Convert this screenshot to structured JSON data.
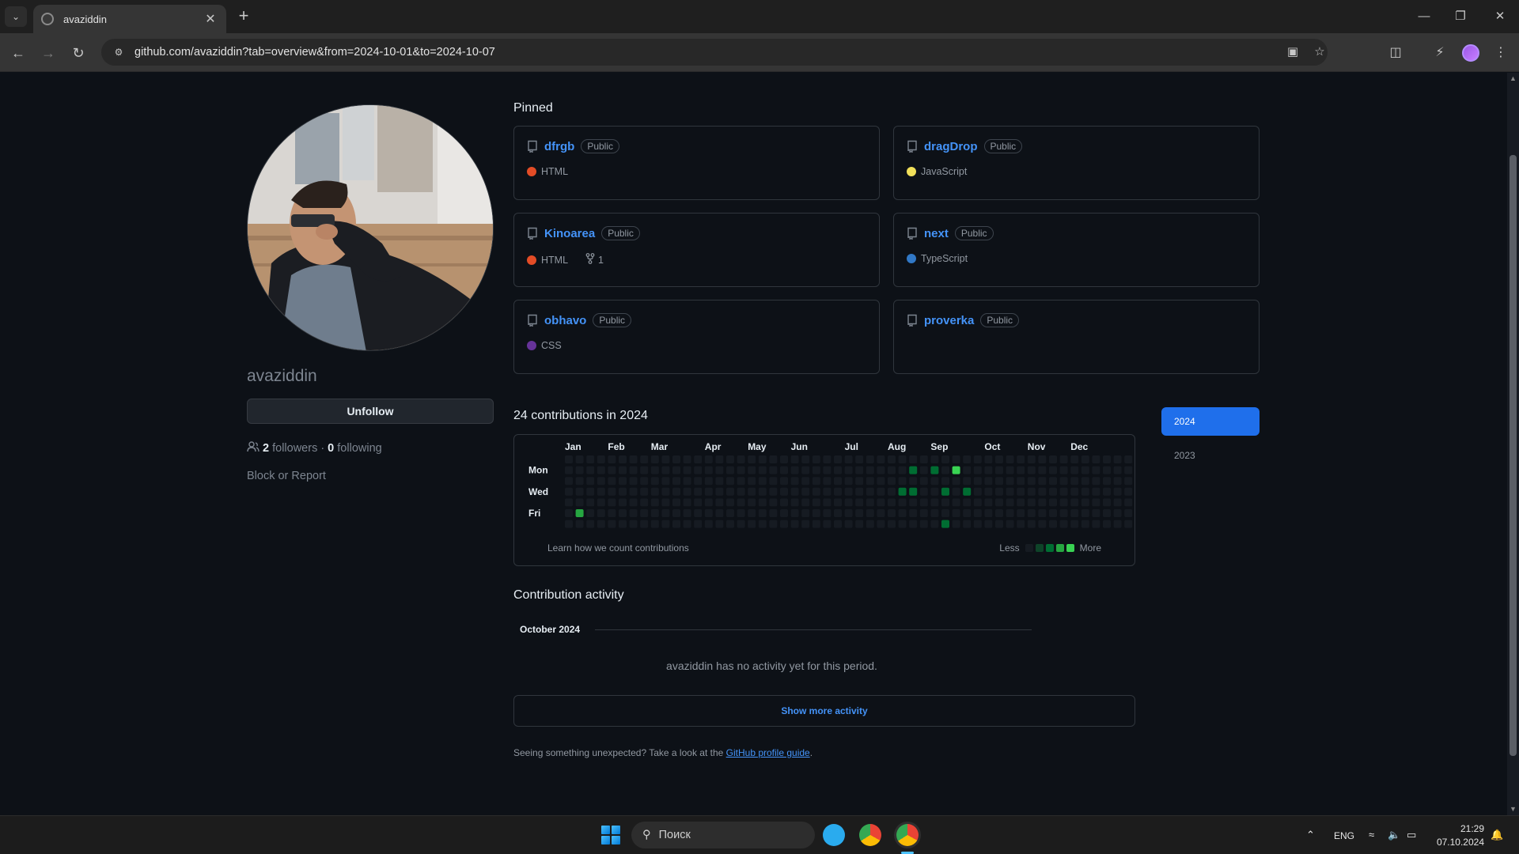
{
  "browser": {
    "tab_title": "avaziddin",
    "url": "github.com/avaziddin?tab=overview&from=2024-10-01&to=2024-10-07"
  },
  "profile": {
    "username": "avaziddin",
    "unfollow_label": "Unfollow",
    "followers_count": "2",
    "followers_label": "followers",
    "separator": "·",
    "following_count": "0",
    "following_label": "following",
    "block_report": "Block or Report"
  },
  "pinned": {
    "title": "Pinned",
    "repos": [
      {
        "name": "dfrgb",
        "visibility": "Public",
        "language": "HTML",
        "lang_color": "#e34c26",
        "forks": ""
      },
      {
        "name": "dragDrop",
        "visibility": "Public",
        "language": "JavaScript",
        "lang_color": "#f1e05a",
        "forks": ""
      },
      {
        "name": "Kinoarea",
        "visibility": "Public",
        "language": "HTML",
        "lang_color": "#e34c26",
        "forks": "1"
      },
      {
        "name": "next",
        "visibility": "Public",
        "language": "TypeScript",
        "lang_color": "#3178c6",
        "forks": ""
      },
      {
        "name": "obhavo",
        "visibility": "Public",
        "language": "CSS",
        "lang_color": "#663399",
        "forks": ""
      },
      {
        "name": "proverka",
        "visibility": "Public",
        "language": "",
        "lang_color": "",
        "forks": ""
      }
    ]
  },
  "contributions": {
    "title": "24 contributions in 2024",
    "months": [
      "Jan",
      "Feb",
      "Mar",
      "Apr",
      "May",
      "Jun",
      "Jul",
      "Aug",
      "Sep",
      "Oct",
      "Nov",
      "Dec"
    ],
    "day_labels": [
      "Mon",
      "Wed",
      "Fri"
    ],
    "learn_link": "Learn how we count contributions",
    "less": "Less",
    "more": "More",
    "level_colors": [
      "#161b22",
      "#0e4429",
      "#006d32",
      "#26a641",
      "#39d353"
    ],
    "active_cells": [
      {
        "week": 1,
        "day": 5,
        "level": 3
      },
      {
        "week": 31,
        "day": 3,
        "level": 2
      },
      {
        "week": 32,
        "day": 1,
        "level": 2
      },
      {
        "week": 32,
        "day": 3,
        "level": 2
      },
      {
        "week": 34,
        "day": 1,
        "level": 2
      },
      {
        "week": 35,
        "day": 3,
        "level": 2
      },
      {
        "week": 35,
        "day": 6,
        "level": 2
      },
      {
        "week": 36,
        "day": 1,
        "level": 4
      },
      {
        "week": 37,
        "day": 3,
        "level": 2
      }
    ]
  },
  "years": {
    "active": "2024",
    "other": "2023"
  },
  "activity": {
    "title": "Contribution activity",
    "month": "October 2024",
    "no_activity": "avaziddin has no activity yet for this period.",
    "show_more": "Show more activity",
    "unexpected_prefix": "Seeing something unexpected? Take a look at the",
    "guide_link": "GitHub profile guide",
    "unexpected_suffix": "."
  },
  "taskbar": {
    "search_placeholder": "Поиск",
    "language": "ENG",
    "time": "21:29",
    "date": "07.10.2024"
  }
}
